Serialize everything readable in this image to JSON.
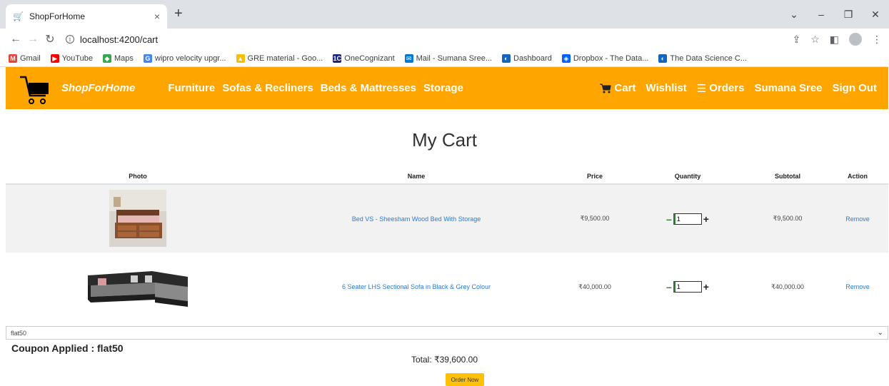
{
  "browser": {
    "tab_title": "ShopForHome",
    "tab_close": "×",
    "new_tab": "+",
    "url": "localhost:4200/cart",
    "bookmarks": [
      {
        "label": "Gmail",
        "color": "#ea4335",
        "icon": "M"
      },
      {
        "label": "YouTube",
        "color": "#ff0000",
        "icon": "▶"
      },
      {
        "label": "Maps",
        "color": "#34a853",
        "icon": "◆"
      },
      {
        "label": "wipro velocity upgr...",
        "color": "#4285f4",
        "icon": "G"
      },
      {
        "label": "GRE material - Goo...",
        "color": "#fbbc04",
        "icon": "▲"
      },
      {
        "label": "OneCognizant",
        "color": "#1a237e",
        "icon": "1C"
      },
      {
        "label": "Mail - Sumana Sree...",
        "color": "#0078d4",
        "icon": "✉"
      },
      {
        "label": "Dashboard",
        "color": "#1565c0",
        "icon": "◐"
      },
      {
        "label": "Dropbox - The Data...",
        "color": "#0061ff",
        "icon": "◈"
      },
      {
        "label": "The Data Science C...",
        "color": "#1565c0",
        "icon": "◐"
      }
    ]
  },
  "navbar": {
    "brand": "ShopForHome",
    "left_links": [
      "Furniture",
      "Sofas & Recliners",
      "Beds & Mattresses",
      "Storage"
    ],
    "cart": "Cart",
    "wishlist": "Wishlist",
    "orders": "Orders",
    "user": "Sumana Sree",
    "signout": "Sign Out",
    "bg_color": "#ffa500"
  },
  "page": {
    "title": "My Cart"
  },
  "table": {
    "headers": [
      "Photo",
      "Name",
      "Price",
      "Quantity",
      "Subtotal",
      "Action"
    ],
    "rows": [
      {
        "name": "Bed VS - Sheesham Wood Bed With Storage",
        "price": "₹9,500.00",
        "quantity": "1",
        "subtotal": "₹9,500.00",
        "action": "Remove"
      },
      {
        "name": "6 Seater LHS Sectional Sofa in Black & Grey Colour",
        "price": "₹40,000.00",
        "quantity": "1",
        "subtotal": "₹40,000.00",
        "action": "Remove"
      }
    ]
  },
  "coupon": {
    "selected": "flat50",
    "applied_text": "Coupon Applied : flat50"
  },
  "summary": {
    "total": "Total: ₹39,600.00",
    "order_button": "Order Now"
  }
}
